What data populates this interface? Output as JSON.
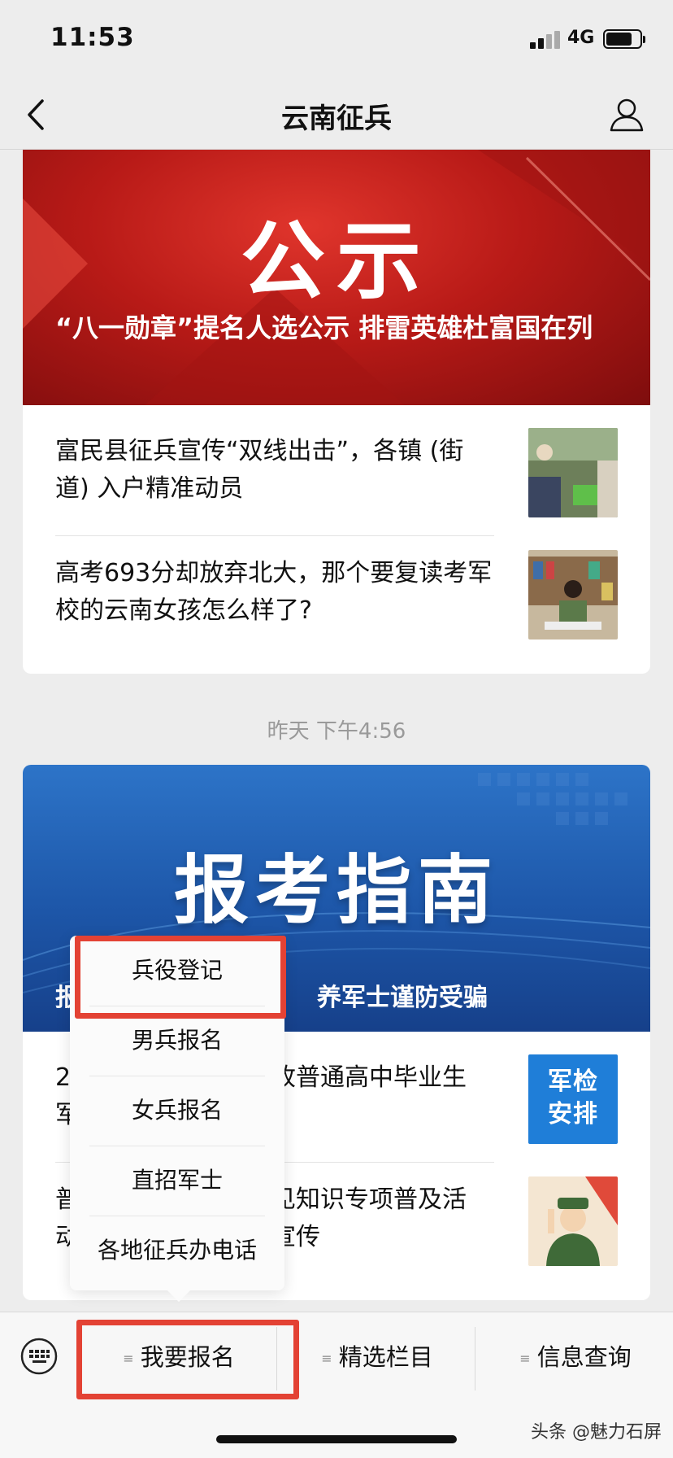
{
  "status_bar": {
    "time": "11:53",
    "network": "4G"
  },
  "nav": {
    "title": "云南征兵"
  },
  "card1": {
    "hero_big_text": "公示",
    "hero_headline": "“八一勋章”提名人选公示 排雷英雄杜富国在列",
    "articles": [
      {
        "title": "富民县征兵宣传“双线出击”，各镇 (街道) 入户精准动员"
      },
      {
        "title": "高考693分却放弃北大，那个要复读考军校的云南女孩怎么样了?"
      }
    ]
  },
  "timestamp": "昨天 下午4:56",
  "card2": {
    "hero_big_text": "报考指南",
    "hero_headline_visible": "养军士谨防受骗",
    "articles": [
      {
        "left_fragment": "2\n军",
        "right_fragment": "收普通高中毕业生",
        "thumb_text": "军检安排"
      },
      {
        "left_fragment": "普\n动",
        "right_fragment": "见知识专项普及活\n宣传"
      }
    ]
  },
  "popup_menu": {
    "items": [
      "兵役登记",
      "男兵报名",
      "女兵报名",
      "直招军士",
      "各地征兵办电话"
    ]
  },
  "bottom_menu": {
    "items": [
      "我要报名",
      "精选栏目",
      "信息查询"
    ]
  },
  "watermark": "头条 @魅力石屏",
  "colors": {
    "highlight": "#e34234",
    "hero_red": "#c21f1a",
    "hero_blue": "#1d56a8"
  }
}
